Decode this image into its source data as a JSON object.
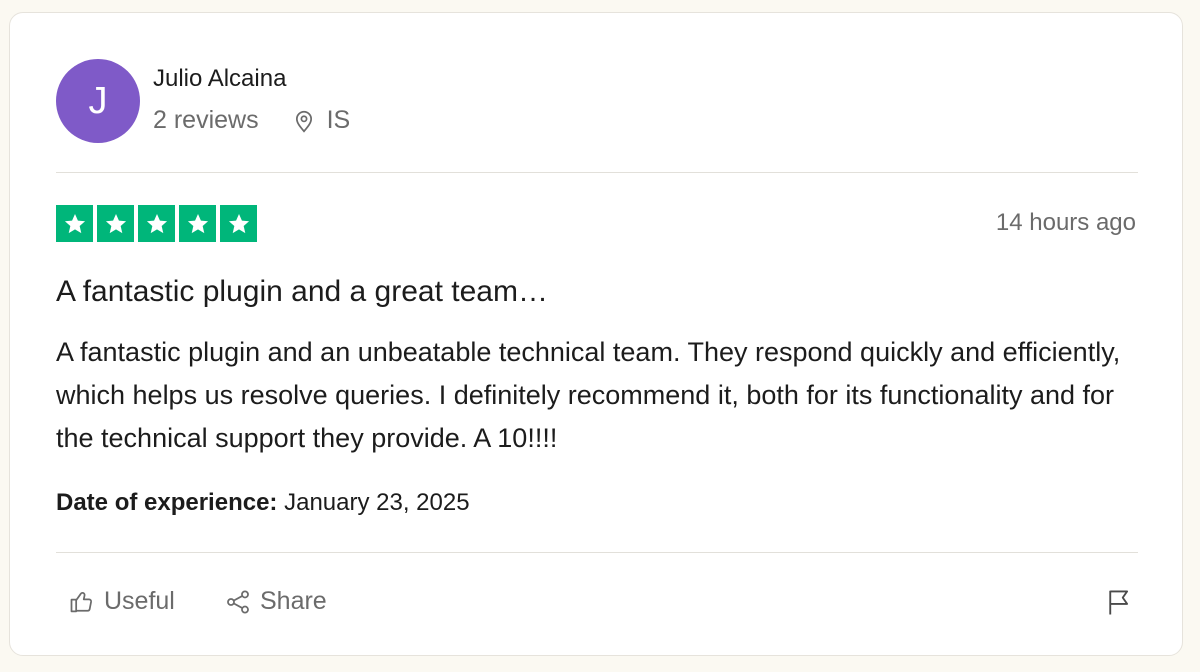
{
  "reviewer": {
    "initial": "J",
    "name": "Julio Alcaina",
    "reviews_count": "2 reviews",
    "location": "IS",
    "avatar_color": "#7f5ac8"
  },
  "review": {
    "rating": 5,
    "rating_max": 5,
    "star_color": "#00b67a",
    "posted": "14 hours ago",
    "title": "A fantastic plugin and a great team…",
    "body": "A fantastic plugin and an unbeatable technical team. They respond quickly and efficiently, which helps us resolve queries. I definitely recommend it, both for its functionality and for the technical support they provide. A 10!!!!",
    "experience_label": "Date of experience:",
    "experience_date": "January 23, 2025"
  },
  "actions": {
    "useful_label": "Useful",
    "useful_icon": "thumbs-up-icon",
    "share_label": "Share",
    "share_icon": "share-icon",
    "flag_icon": "flag-icon"
  }
}
